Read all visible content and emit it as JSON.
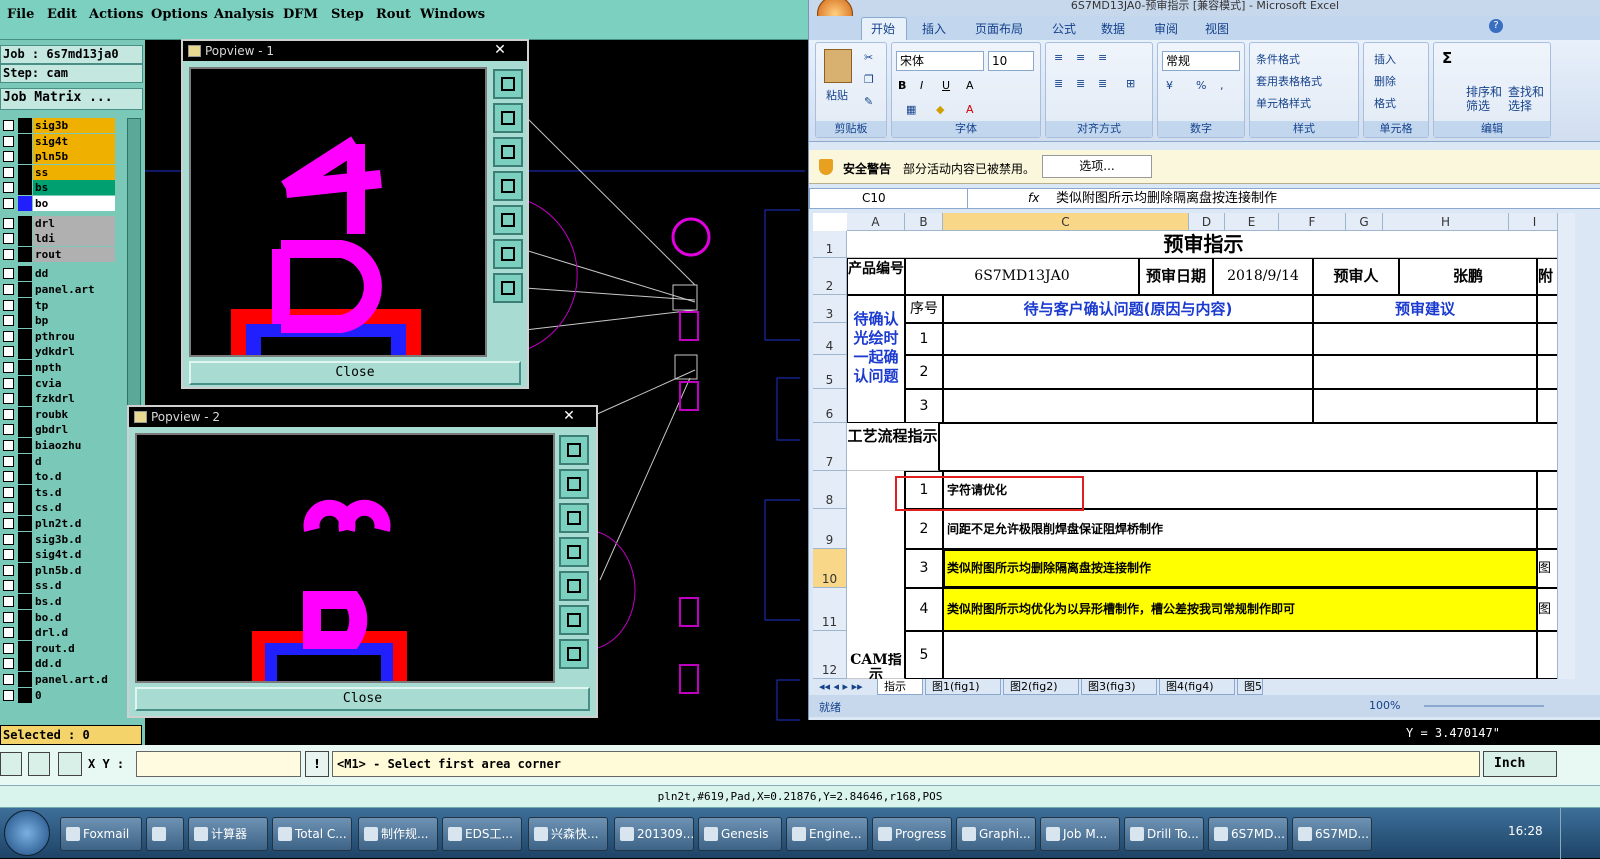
{
  "genesis": {
    "menu": [
      "File",
      "Edit",
      "Actions",
      "Options",
      "Analysis",
      "DFM",
      "Step",
      "Rout",
      "Windows"
    ],
    "job_label": "Job : 6s7md13ja0",
    "step_label": "Step: cam",
    "matrix_button": "Job Matrix ...",
    "layers": [
      {
        "name": "sig3b",
        "color": "#f0b000"
      },
      {
        "name": "sig4t",
        "color": "#f0b000"
      },
      {
        "name": "pln5b",
        "color": "#f0b000"
      },
      {
        "name": "ss",
        "color": "#f0b000"
      },
      {
        "name": "bs",
        "color": "#00a070"
      },
      {
        "name": "bo",
        "color": "#ffffff",
        "active": true
      },
      {
        "name": "drl",
        "color": "#b0b0b0"
      },
      {
        "name": "ldi",
        "color": "#b0b0b0"
      },
      {
        "name": "rout",
        "color": "#b0b0b0"
      },
      {
        "name": "dd",
        "color": "#79c8b8"
      },
      {
        "name": "panel.art",
        "color": "#79c8b8"
      },
      {
        "name": "tp",
        "color": "#79c8b8"
      },
      {
        "name": "bp",
        "color": "#79c8b8"
      },
      {
        "name": "pthrou",
        "color": "#79c8b8"
      },
      {
        "name": "ydkdrl",
        "color": "#79c8b8"
      },
      {
        "name": "npth",
        "color": "#79c8b8"
      },
      {
        "name": "cvia",
        "color": "#79c8b8"
      },
      {
        "name": "fzkdrl",
        "color": "#79c8b8"
      },
      {
        "name": "roubk",
        "color": "#79c8b8"
      },
      {
        "name": "gbdrl",
        "color": "#79c8b8"
      },
      {
        "name": "biaozhu",
        "color": "#79c8b8"
      },
      {
        "name": "d",
        "color": "#79c8b8"
      },
      {
        "name": "to.d",
        "color": "#79c8b8"
      },
      {
        "name": "ts.d",
        "color": "#79c8b8"
      },
      {
        "name": "cs.d",
        "color": "#79c8b8"
      },
      {
        "name": "pln2t.d",
        "color": "#79c8b8"
      },
      {
        "name": "sig3b.d",
        "color": "#79c8b8"
      },
      {
        "name": "sig4t.d",
        "color": "#79c8b8"
      },
      {
        "name": "pln5b.d",
        "color": "#79c8b8"
      },
      {
        "name": "ss.d",
        "color": "#79c8b8"
      },
      {
        "name": "bs.d",
        "color": "#79c8b8"
      },
      {
        "name": "bo.d",
        "color": "#79c8b8"
      },
      {
        "name": "drl.d",
        "color": "#79c8b8"
      },
      {
        "name": "rout.d",
        "color": "#79c8b8"
      },
      {
        "name": "dd.d",
        "color": "#79c8b8"
      },
      {
        "name": "panel.art.d",
        "color": "#79c8b8"
      },
      {
        "name": "0",
        "color": "#79c8b8"
      }
    ],
    "popview1": {
      "title": "Popview - 1",
      "close_label": "Close",
      "x_label": "✕",
      "glyph_top": "4",
      "glyph_bottom": "D"
    },
    "popview2": {
      "title": "Popview - 2",
      "close_label": "Close",
      "x_label": "✕",
      "glyph_top": "3",
      "glyph_bottom": "D"
    },
    "selected_label": "Selected : 0",
    "xy_label": "X Y :",
    "xy_value": "",
    "prompt": "<M1> - Select first area corner",
    "y_readout": "Y = 3.470147\"",
    "units": "Inch",
    "coord_status": "pln2t,#619,Pad,X=0.21876,Y=2.84646,r168,POS"
  },
  "excel": {
    "title": "6S7MD13JA0-预审指示 [兼容模式] - Microsoft Excel",
    "tabs": [
      "开始",
      "插入",
      "页面布局",
      "公式",
      "数据",
      "审阅",
      "视图"
    ],
    "ribbon": {
      "paste": "粘贴",
      "clipboard": "剪贴板",
      "font_name": "宋体",
      "font_size": "10",
      "font_group": "字体",
      "align_group": "对齐方式",
      "number_format": "常规",
      "number_group": "数字",
      "cond_format": "条件格式",
      "table_format": "套用表格格式",
      "cell_style": "单元格样式",
      "style_group": "样式",
      "insert": "插入",
      "delete": "删除",
      "format": "格式",
      "cells_group": "单元格",
      "sort": "排序和筛选",
      "find": "查找和选择",
      "edit_group": "编辑"
    },
    "security_label": "安全警告",
    "security_msg": "部分活动内容已被禁用。",
    "options_button": "选项...",
    "name_box": "C10",
    "formula": "类似附图所示均删除隔离盘按连接制作",
    "columns": [
      "A",
      "B",
      "C",
      "D",
      "E",
      "F",
      "G",
      "H",
      "I"
    ],
    "rows": [
      "1",
      "2",
      "3",
      "4",
      "5",
      "6",
      "7",
      "8",
      "9",
      "10",
      "11",
      "12"
    ],
    "sheet": {
      "title": "预审指示",
      "product_label": "产品编号",
      "product_no": "6S7MD13JA0",
      "date_label": "预审日期",
      "date": "2018/9/14",
      "reviewer_label": "预审人",
      "reviewer": "张鹏",
      "attach": "附",
      "seq_label": "序号",
      "issue_header": "待与客户确认问题(原因与内容)",
      "suggest_header": "预审建议",
      "confirm_label": "待确认光绘时一起确认问题",
      "seq": [
        "1",
        "2",
        "3"
      ],
      "process_label": "工艺流程指示",
      "items": [
        {
          "no": "1",
          "text": "字符请优化"
        },
        {
          "no": "2",
          "text": "间距不足允许极限削焊盘保证阻焊桥制作"
        },
        {
          "no": "3",
          "text": "类似附图所示均删除隔离盘按连接制作"
        },
        {
          "no": "4",
          "text": "类似附图所示均优化为以异形槽制作，槽公差按我司常规制作即可"
        },
        {
          "no": "5",
          "text": ""
        }
      ],
      "cam_label": "CAM指示",
      "side_mark": "图"
    },
    "sheet_tabs": [
      "指示",
      "图1(fig1)",
      "图2(fig2)",
      "图3(fig3)",
      "图4(fig4)",
      "图5"
    ],
    "status_ready": "就绪",
    "zoom": "100%"
  },
  "taskbar": {
    "items": [
      "Foxmail",
      "",
      "计算器",
      "Total C...",
      "制作规...",
      "EDS工...",
      "兴森快...",
      "201309...",
      "Genesis",
      "Engine...",
      "Progress",
      "Graphi...",
      "Job M...",
      "Drill To...",
      "6S7MD...",
      "6S7MD..."
    ],
    "time": "16:28"
  }
}
